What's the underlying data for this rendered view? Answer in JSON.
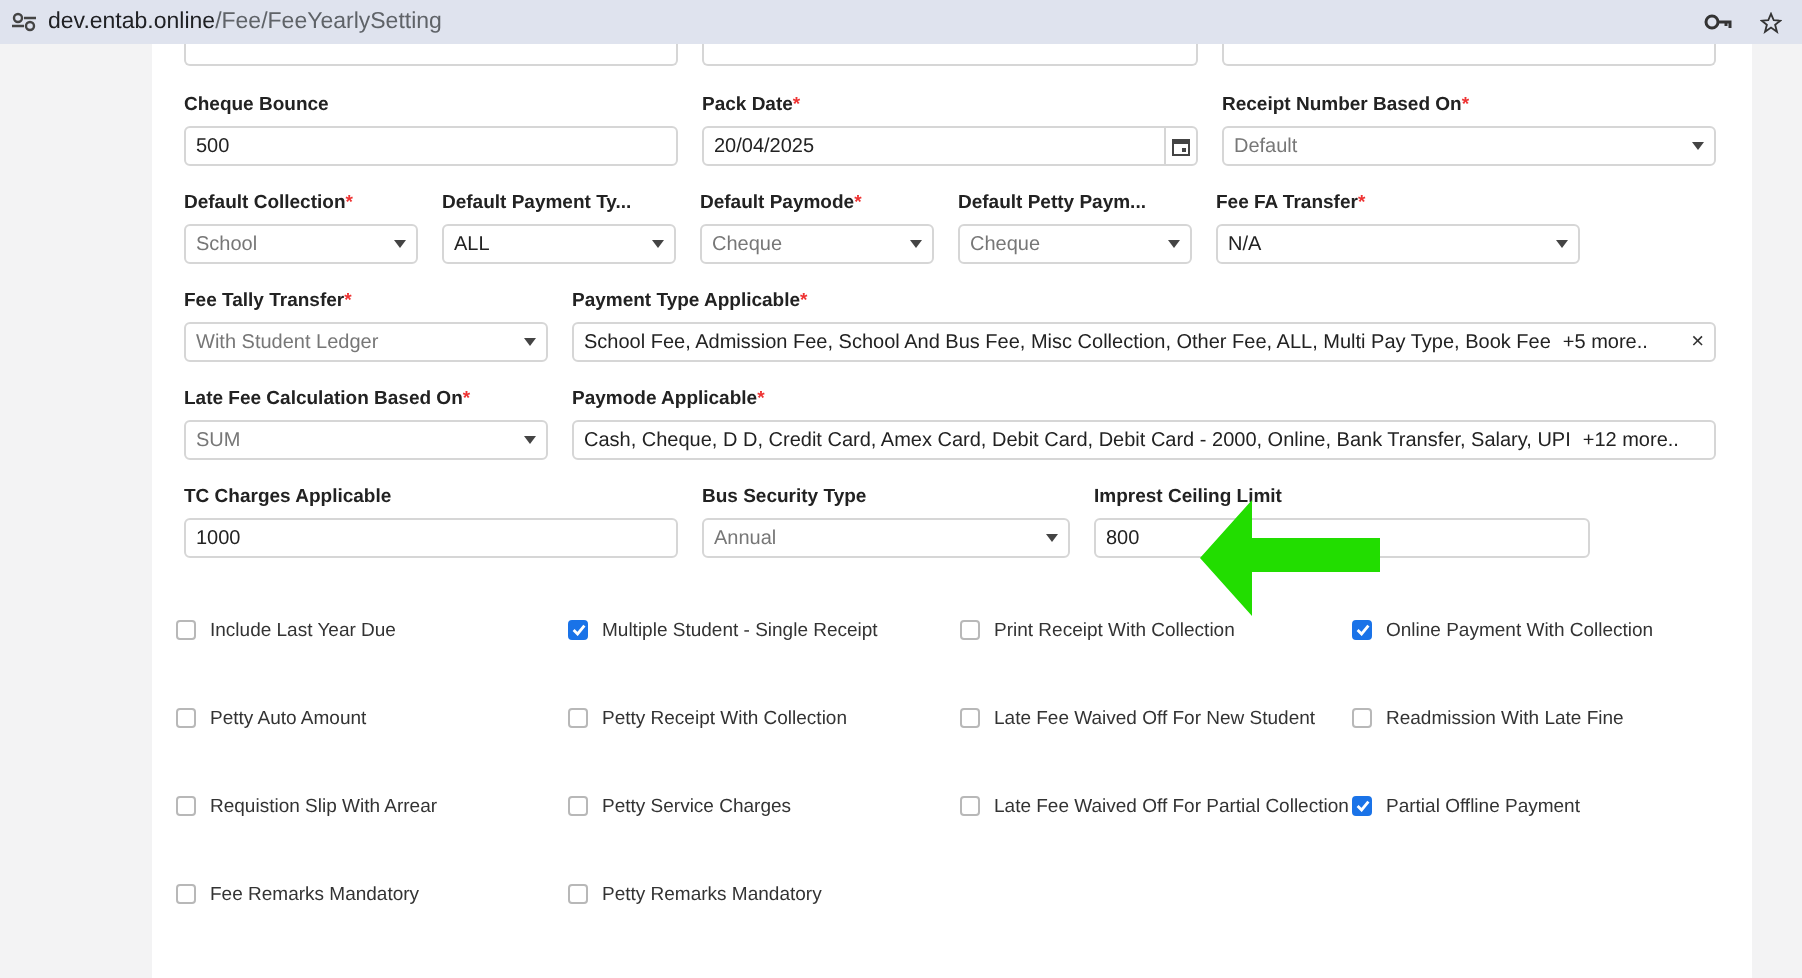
{
  "browser": {
    "url_host": "dev.entab.online",
    "url_path": "/Fee/FeeYearlySetting"
  },
  "rows": [
    {
      "fields": [
        {
          "kind": "stub"
        },
        {
          "kind": "stub"
        },
        {
          "kind": "stub"
        }
      ]
    },
    {
      "fields": [
        {
          "label": "Cheque Bounce",
          "kind": "text",
          "value": "500",
          "disabled": false
        },
        {
          "label": "Pack Date",
          "required_mark": "*",
          "kind": "date",
          "value": "20/04/2025",
          "disabled": false
        },
        {
          "label": "Receipt Number Based On",
          "required_mark": "*",
          "kind": "select",
          "value": "Default",
          "disabled": true
        }
      ]
    },
    {
      "fields": [
        {
          "label": "Default Collection",
          "required_mark": "*",
          "kind": "select",
          "value": "School",
          "disabled": true
        },
        {
          "label": "Default Payment Ty...",
          "kind": "select",
          "value": "ALL",
          "disabled": false
        },
        {
          "label": "Default Paymode",
          "required_mark": "*",
          "kind": "select",
          "value": "Cheque",
          "disabled": true
        },
        {
          "label": "Default Petty Paym...",
          "kind": "select",
          "value": "Cheque",
          "disabled": true
        },
        {
          "label": "Fee FA Transfer",
          "required_mark": "*",
          "kind": "select",
          "value": "N/A",
          "disabled": false
        }
      ]
    },
    {
      "fields": [
        {
          "label": "Fee Tally Transfer",
          "required_mark": "*",
          "kind": "select",
          "value": "With Student Ledger",
          "disabled": true
        },
        {
          "label": "Payment Type Applicable",
          "required_mark": "*",
          "kind": "multiselect",
          "value": "School Fee, Admission Fee, School And Bus Fee, Misc Collection, Other Fee, ALL, Multi Pay Type, Book Fee",
          "more": "+5 more..",
          "clear": "×",
          "disabled": false
        }
      ]
    },
    {
      "fields": [
        {
          "label": "Late Fee Calculation Based On",
          "required_mark": "*",
          "kind": "select",
          "value": "SUM",
          "disabled": true
        },
        {
          "label": "Paymode Applicable",
          "required_mark": "*",
          "kind": "multiselect",
          "value": "Cash, Cheque, D D, Credit Card, Amex Card, Debit Card, Debit Card - 2000, Online, Bank Transfer, Salary, UPI",
          "more": "+12 more..",
          "disabled": false
        }
      ]
    },
    {
      "fields": [
        {
          "label": "TC Charges Applicable",
          "kind": "text",
          "value": "1000",
          "disabled": false
        },
        {
          "label": "Bus Security Type",
          "kind": "select",
          "value": "Annual",
          "disabled": true
        },
        {
          "label": "Imprest Ceiling Limit",
          "kind": "text",
          "value": "800",
          "disabled": false
        }
      ]
    }
  ],
  "checkboxes": [
    {
      "label": "Include Last Year Due",
      "checked": false
    },
    {
      "label": "Multiple Student - Single Receipt",
      "checked": true
    },
    {
      "label": "Print Receipt With Collection",
      "checked": false
    },
    {
      "label": "Online Payment With Collection",
      "checked": true
    },
    {
      "label": "Petty Auto Amount",
      "checked": false
    },
    {
      "label": "Petty Receipt With Collection",
      "checked": false
    },
    {
      "label": "Late Fee Waived Off For New Student",
      "checked": false
    },
    {
      "label": "Readmission With Late Fine",
      "checked": false
    },
    {
      "label": "Requistion Slip With Arrear",
      "checked": false
    },
    {
      "label": "Petty Service Charges",
      "checked": false
    },
    {
      "label": "Late Fee Waived Off For Partial Collection",
      "checked": false
    },
    {
      "label": "Partial Offline Payment",
      "checked": true
    },
    {
      "label": "Fee Remarks Mandatory",
      "checked": false
    },
    {
      "label": "Petty Remarks Mandatory",
      "checked": false
    }
  ],
  "annotation": {
    "kind": "arrow",
    "color": "#22dd00"
  }
}
